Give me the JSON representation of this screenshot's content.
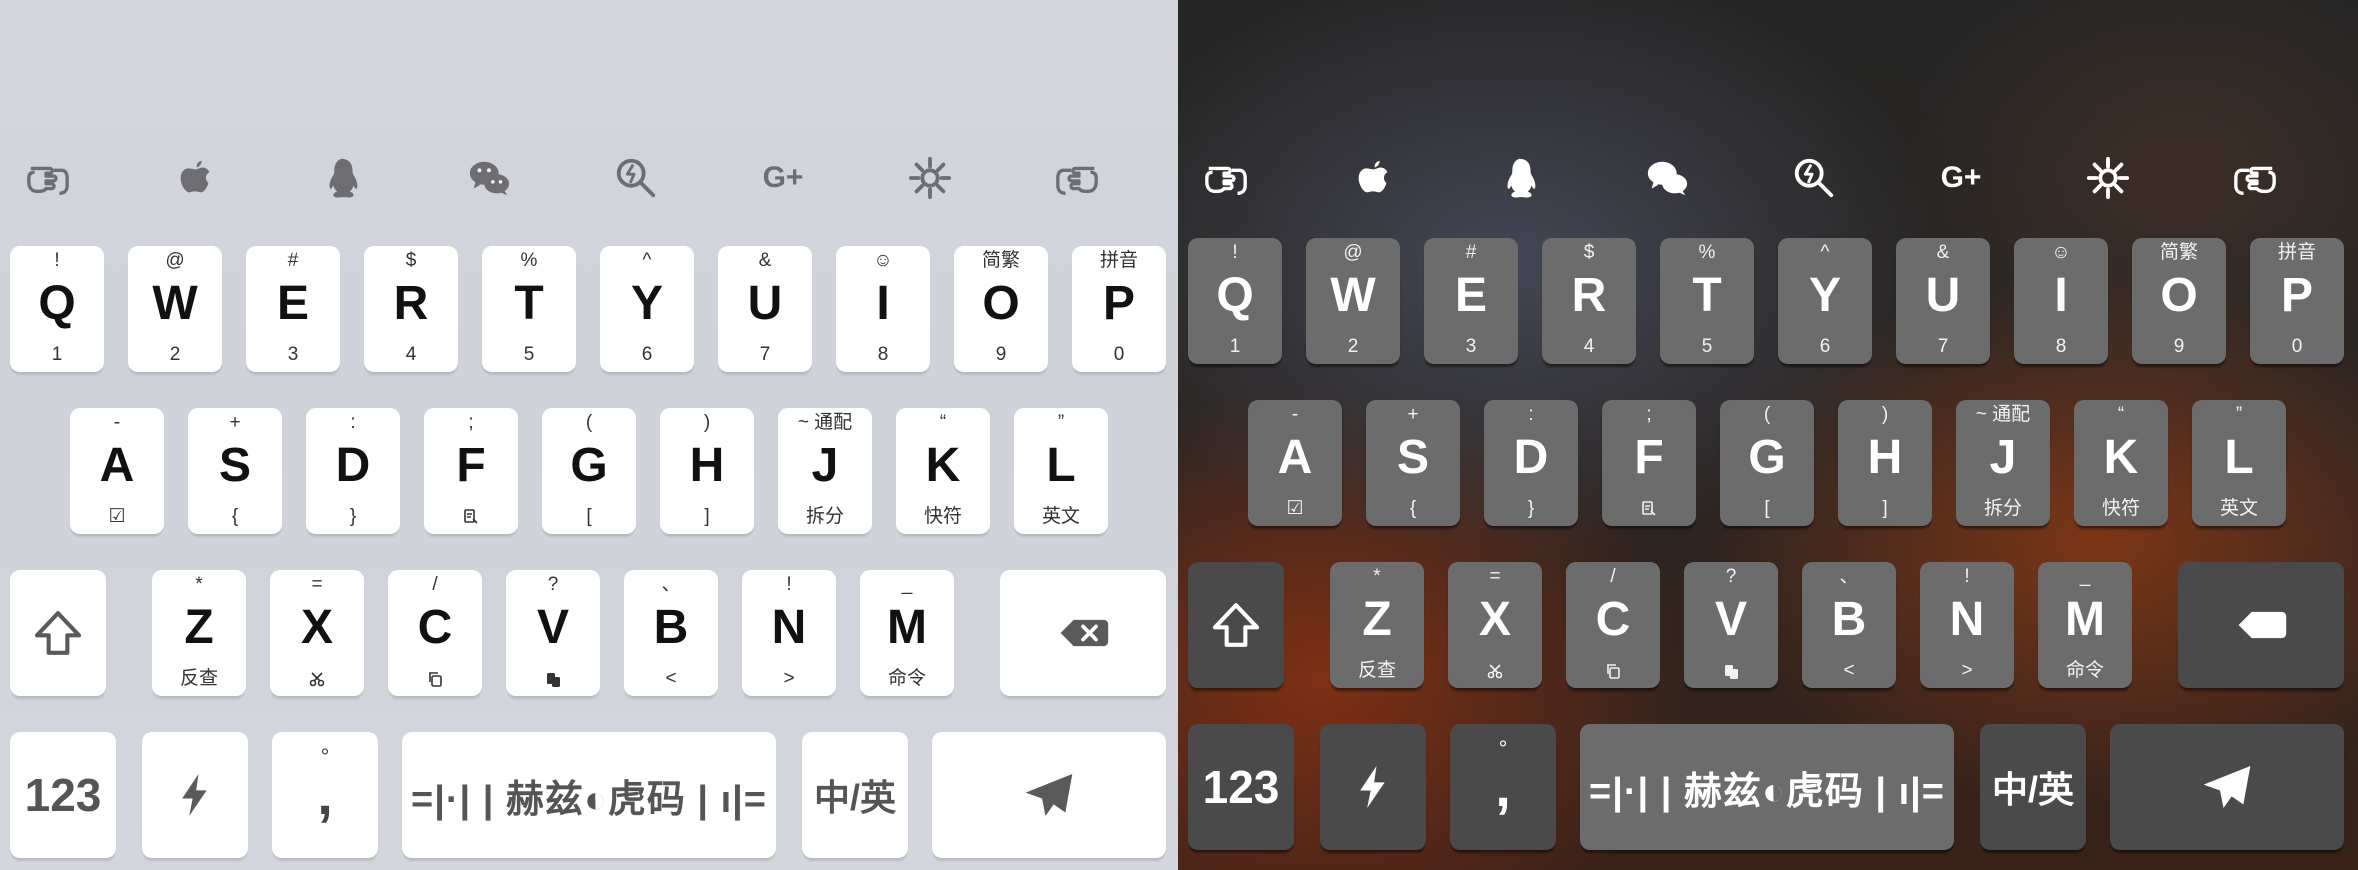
{
  "toolbar_icons": [
    "hand-point-left-icon",
    "apple-icon",
    "qq-penguin-icon",
    "wechat-icon",
    "search-bolt-icon",
    "google-plus-icon",
    "settings-gear-icon",
    "hand-point-right-icon"
  ],
  "toolbar_glyphs": {
    "google_plus": "G+"
  },
  "row1": [
    {
      "top": "!",
      "main": "Q",
      "bot": "1"
    },
    {
      "top": "@",
      "main": "W",
      "bot": "2"
    },
    {
      "top": "#",
      "main": "E",
      "bot": "3"
    },
    {
      "top": "$",
      "main": "R",
      "bot": "4"
    },
    {
      "top": "%",
      "main": "T",
      "bot": "5"
    },
    {
      "top": "^",
      "main": "Y",
      "bot": "6"
    },
    {
      "top": "&",
      "main": "U",
      "bot": "7"
    },
    {
      "top": "☺",
      "main": "I",
      "bot": "8"
    },
    {
      "top": "简繁",
      "main": "O",
      "bot": "9"
    },
    {
      "top": "拼音",
      "main": "P",
      "bot": "0"
    }
  ],
  "row2": [
    {
      "top": "-",
      "main": "A",
      "bot": "☑"
    },
    {
      "top": "+",
      "main": "S",
      "bot": "{"
    },
    {
      "top": ":",
      "main": "D",
      "bot": "}"
    },
    {
      "top": ";",
      "main": "F",
      "bot": ""
    },
    {
      "top": "(",
      "main": "G",
      "bot": "["
    },
    {
      "top": ")",
      "main": "H",
      "bot": "]"
    },
    {
      "top": "~ 通配",
      "main": "J",
      "bot": "拆分"
    },
    {
      "top": "“",
      "main": "K",
      "bot": "快符"
    },
    {
      "top": "”",
      "main": "L",
      "bot": "英文"
    }
  ],
  "row3": [
    {
      "top": "*",
      "main": "Z",
      "bot": "反查"
    },
    {
      "top": "=",
      "main": "X",
      "bot": ""
    },
    {
      "top": "/",
      "main": "C",
      "bot": ""
    },
    {
      "top": "?",
      "main": "V",
      "bot": ""
    },
    {
      "top": "、",
      "main": "B",
      "bot": "<"
    },
    {
      "top": "!",
      "main": "N",
      "bot": ">"
    },
    {
      "top": "_",
      "main": "M",
      "bot": "命令"
    }
  ],
  "bottom_row": {
    "numbers_label": "123",
    "comma_top": "°",
    "comma_main": ",",
    "space_label": "=|·| | 赫兹◐虎码 | ı|=",
    "lang_label": "中/英"
  },
  "themes": {
    "light_key": "#ffffff",
    "dark_key": "#6c6c6c",
    "dark_func_key": "#4a4a4a"
  }
}
